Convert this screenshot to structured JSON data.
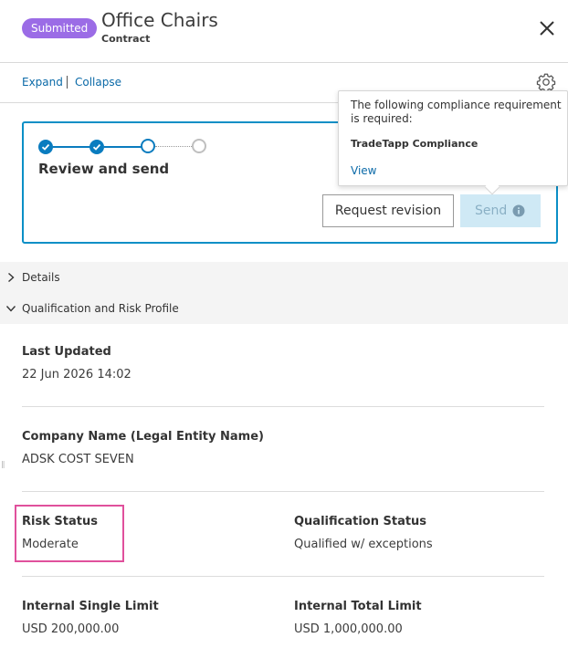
{
  "header": {
    "status_badge": "Submitted",
    "title": "Office Chairs",
    "subtitle": "Contract"
  },
  "toolbar": {
    "expand_label": "Expand",
    "collapse_label": "Collapse"
  },
  "workflow": {
    "title": "Review and send",
    "steps": [
      "complete",
      "complete",
      "current",
      "upcoming"
    ],
    "request_revision_label": "Request revision",
    "send_label": "Send"
  },
  "tooltip": {
    "message": "The following compliance requirement is required:",
    "requirement": "TradeTapp Compliance",
    "view_label": "View"
  },
  "sections": {
    "details": {
      "label": "Details",
      "expanded": false
    },
    "qualification": {
      "label": "Qualification and Risk Profile",
      "expanded": true
    }
  },
  "fields": {
    "last_updated": {
      "label": "Last Updated",
      "value": "22 Jun 2026 14:02"
    },
    "company_name": {
      "label": "Company Name (Legal Entity Name)",
      "value": "ADSK COST SEVEN"
    },
    "risk_status": {
      "label": "Risk Status",
      "value": "Moderate"
    },
    "qualification_status": {
      "label": "Qualification Status",
      "value": "Qualified w/ exceptions"
    },
    "internal_single_limit": {
      "label": "Internal Single Limit",
      "value": "USD 200,000.00"
    },
    "internal_total_limit": {
      "label": "Internal Total Limit",
      "value": "USD 1,000,000.00"
    }
  },
  "colors": {
    "badge": "#9b6ce6",
    "accent": "#0a7cbf",
    "link": "#0b6aa8",
    "highlight": "#e0509c",
    "send_disabled": "#cfe9f5"
  },
  "icons": {
    "close": "close-icon",
    "settings": "gear-icon",
    "info": "info-icon",
    "check": "check-icon",
    "chevron_right": "chevron-right-icon",
    "chevron_down": "chevron-down-icon"
  }
}
